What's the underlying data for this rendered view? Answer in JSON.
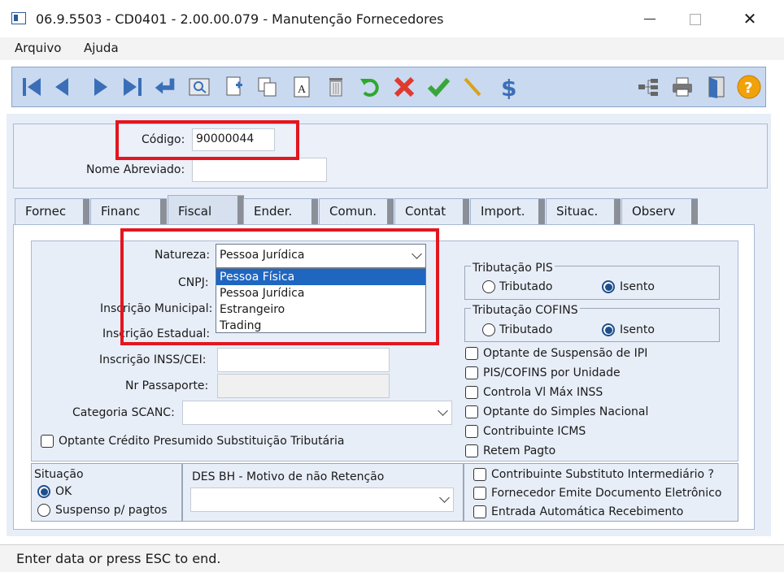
{
  "window": {
    "title": "06.9.5503 - CD0401 - 2.00.00.079 - Manutenção Fornecedores"
  },
  "menu": {
    "items": [
      "Arquivo",
      "Ajuda"
    ]
  },
  "header": {
    "codigo_label": "Código:",
    "codigo_value": "90000044",
    "nome_label": "Nome Abreviado:",
    "nome_value": ""
  },
  "tabs": [
    "Fornec",
    "Financ",
    "Fiscal",
    "Ender.",
    "Comun.",
    "Contat",
    "Import.",
    "Situac.",
    "Observ"
  ],
  "active_tab": "Fiscal",
  "fiscal": {
    "natureza_label": "Natureza:",
    "natureza_value": "Pessoa Jurídica",
    "natureza_options": [
      "Pessoa Física",
      "Pessoa Jurídica",
      "Estrangeiro",
      "Trading"
    ],
    "cnpj_label": "CNPJ:",
    "insc_municipal_label": "Inscrição Municipal:",
    "insc_estadual_label": "Inscrição Estadual:",
    "insc_inss_label": "Inscrição INSS/CEI:",
    "nr_passaporte_label": "Nr Passaporte:",
    "categoria_label": "Categoria SCANC:",
    "optante_credito_label": "Optante Crédito Presumido Substituição Tributária",
    "trib_pis": {
      "title": "Tributação PIS",
      "opt1": "Tributado",
      "opt2": "Isento",
      "selected": "Isento"
    },
    "trib_cofins": {
      "title": "Tributação COFINS",
      "opt1": "Tributado",
      "opt2": "Isento",
      "selected": "Isento"
    },
    "checks": [
      "Optante de Suspensão de IPI",
      "PIS/COFINS por Unidade",
      "Controla Vl Máx INSS",
      "Optante do Simples Nacional",
      "Contribuinte ICMS",
      "Retem Pagto"
    ]
  },
  "bottom": {
    "situacao_title": "Situação",
    "situacao_ok": "OK",
    "situacao_susp": "Suspenso p/ pagtos",
    "des_label": "DES BH - Motivo de não Retenção",
    "checks": [
      "Contribuinte Substituto Intermediário ?",
      "Fornecedor Emite Documento Eletrônico",
      "Entrada Automática Recebimento"
    ]
  },
  "status": {
    "text": "Enter data or press ESC to end."
  },
  "colors": {
    "accent": "#1f66c1",
    "highlight_box": "#e3161f",
    "toolbar_bg": "#c9d9f0"
  },
  "toolbar_icons": [
    "first-icon",
    "prev-icon",
    "next-icon",
    "last-icon",
    "enter-icon",
    "zoom-icon",
    "new-icon",
    "copy-icon",
    "edit-icon",
    "delete-icon",
    "undo-icon",
    "cancel-icon",
    "confirm-icon",
    "pencil-icon",
    "dollar-icon",
    "tree-icon",
    "print-icon",
    "exit-icon",
    "help-icon"
  ]
}
